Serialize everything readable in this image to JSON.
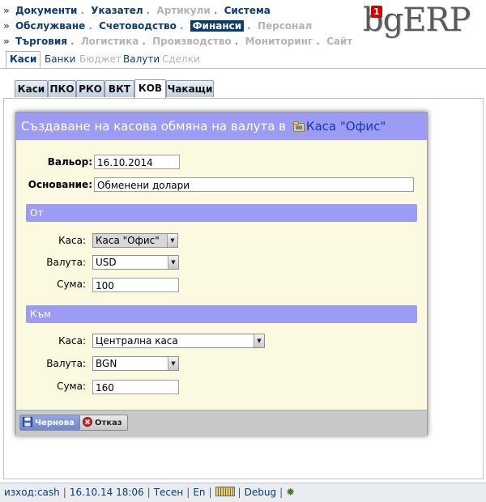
{
  "top_menu": {
    "rows": [
      [
        {
          "label": "Документи",
          "state": "normal"
        },
        {
          "label": "Указател",
          "state": "normal"
        },
        {
          "label": "Артикули",
          "state": "disabled"
        },
        {
          "label": "Система",
          "state": "normal"
        }
      ],
      [
        {
          "label": "Обслужване",
          "state": "normal"
        },
        {
          "label": "Счетоводство",
          "state": "normal"
        },
        {
          "label": "Финанси",
          "state": "active"
        },
        {
          "label": "Персонал",
          "state": "disabled"
        }
      ],
      [
        {
          "label": "Търговия",
          "state": "normal"
        },
        {
          "label": "Логистика",
          "state": "disabled"
        },
        {
          "label": "Производство",
          "state": "disabled"
        },
        {
          "label": "Мониторинг",
          "state": "disabled"
        },
        {
          "label": "Сайт",
          "state": "disabled"
        }
      ]
    ],
    "bullet": "»",
    "separator": "."
  },
  "logo": {
    "text": "bgERP",
    "badge": "1"
  },
  "sub_menu": {
    "items": [
      {
        "label": "Каси",
        "state": "active"
      },
      {
        "label": "Банки",
        "state": "normal"
      },
      {
        "label": "Бюджет",
        "state": "disabled"
      },
      {
        "label": "Валути",
        "state": "normal"
      },
      {
        "label": "Сделки",
        "state": "disabled"
      }
    ]
  },
  "tabs": [
    {
      "label": "Каси",
      "active": false
    },
    {
      "label": "ПКО",
      "active": false
    },
    {
      "label": "РКО",
      "active": false
    },
    {
      "label": "ВКТ",
      "active": false
    },
    {
      "label": "КОВ",
      "active": true
    },
    {
      "label": "Чакащи",
      "active": false
    }
  ],
  "dialog": {
    "title_prefix": "Създаване на касова обмяна на валута в",
    "title_link": "Каса \"Офис\"",
    "valior_label": "Вальор",
    "valior_value": "16.10.2014",
    "reason_label": "Основание",
    "reason_value": "Обменени долари",
    "from_section": "От",
    "from": {
      "cash_label": "Каса",
      "cash_value": "Каса \"Офис\"",
      "currency_label": "Валута",
      "currency_value": "USD",
      "amount_label": "Сума",
      "amount_value": "100"
    },
    "to_section": "Към",
    "to": {
      "cash_label": "Каса",
      "cash_value": "Централна каса",
      "currency_label": "Валута",
      "currency_value": "BGN",
      "amount_label": "Сума",
      "amount_value": "160"
    },
    "draft_button": "Чернова",
    "cancel_button": "Отказ"
  },
  "footer": {
    "user": "изход:cash",
    "datetime": "16.10.14 18:06",
    "mode": "Тесен",
    "lang": "En",
    "debug": "Debug"
  },
  "colors": {
    "title_bar": "#9c9cf5",
    "dialog_bg": "#fbf9df",
    "menu_text": "#0b3d73",
    "active_menu_bg": "#0b3d73"
  }
}
